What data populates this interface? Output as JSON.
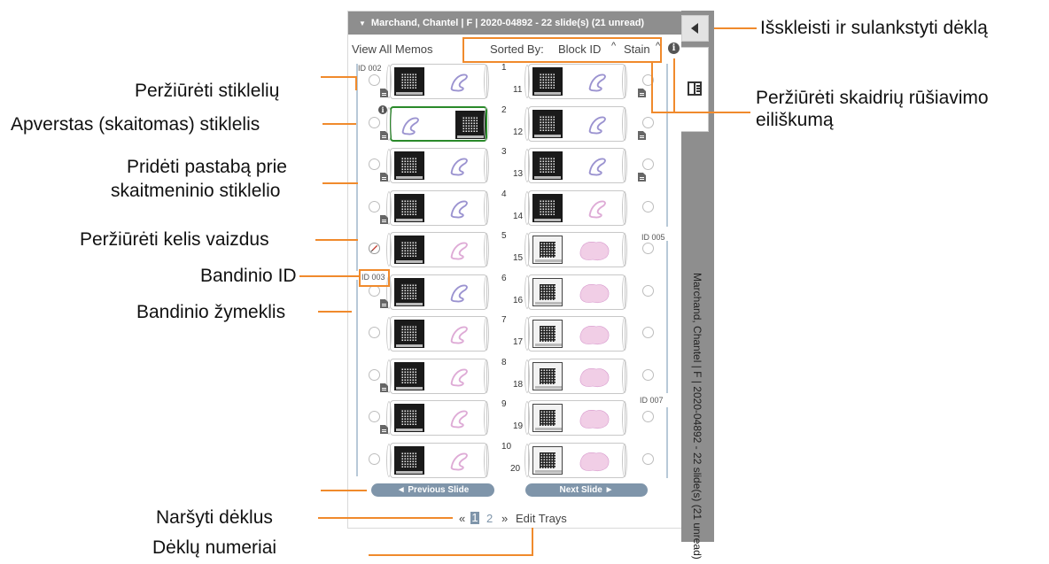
{
  "panel": {
    "header": "Marchand, Chantel | F | 2020-04892 - 22 slide(s) (21 unread)",
    "view_all_memos": "View All Memos",
    "sorted_by_label": "Sorted By:",
    "sort_block": "Block ID",
    "sort_stain": "Stain",
    "sort_arrow": "^",
    "info_glyph": "i",
    "ids": [
      "ID 002",
      "ID 003",
      "ID 005",
      "ID 007"
    ],
    "slide_numbers": [
      "1",
      "2",
      "3",
      "4",
      "5",
      "6",
      "7",
      "8",
      "9",
      "10",
      "11",
      "12",
      "13",
      "14",
      "15",
      "16",
      "17",
      "18",
      "19",
      "20"
    ],
    "prev_slide": "◄  Previous Slide",
    "next_slide": "Next Slide  ►",
    "pager": {
      "prev": "«",
      "page1": "1",
      "page2": "2",
      "next": "»",
      "edit": "Edit Trays"
    },
    "side_text": "Marchand, Chantel | F | 2020-04892 - 22 slide(s) (21 unread)"
  },
  "callouts": {
    "expand_collapse": "Išskleisti ir sulankstyti dėklą",
    "sort_order_1": "Peržiūrėti skaidrių rūšiavimo",
    "sort_order_2": "eiliškumą",
    "view_slides": "Peržiūrėti stiklelių",
    "flipped": "Apverstas (skaitomas) stiklelis",
    "add_note_1": "Pridėti pastabą prie",
    "add_note_2": "skaitmeninio stiklelio",
    "multi_images": "Peržiūrėti kelis vaizdus",
    "specimen_id": "Bandinio ID",
    "specimen_marker": "Bandinio žymeklis",
    "browse_trays": "Naršyti dėklus",
    "tray_numbers": "Dėklų numeriai"
  },
  "colors": {
    "accent": "#f08a2c",
    "header_gray": "#8e8e8e",
    "nav_button": "#7f95aa",
    "active_slide": "#2a8a2a",
    "stain_purple": "#7a6fc0",
    "stain_pink": "#d38fc8"
  }
}
